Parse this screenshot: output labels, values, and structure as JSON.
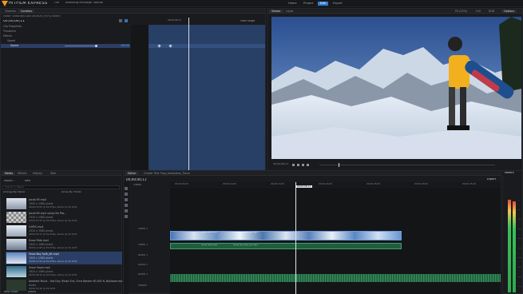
{
  "app": {
    "name": "HITFILM EXPRESS",
    "file_menu": "File",
    "project_title": "Boarding Montage Tutorial"
  },
  "workspace_tabs": [
    "Home",
    "Project",
    "Edit",
    "Export"
  ],
  "workspace_active": "Edit",
  "controls_panel": {
    "tabs": [
      "Trimmer",
      "Controls"
    ],
    "active_tab": "Controls",
    "header": "Editor: Snow Boy Split Alt(HDR_FNTN_Folder)",
    "timecode": "00;00;06;11",
    "ruler_label": "00;00;06;11",
    "view_label": "View Single",
    "tree": [
      "Clip Properties",
      "Transform",
      "Effects",
      "Speed",
      "Speed"
    ],
    "speed_value": "100.00"
  },
  "viewer": {
    "tabs": [
      "Viewer",
      "Layer"
    ],
    "active_tab": "Viewer",
    "zoom": "Fit (25%)",
    "quality": "Full",
    "colorspace": "RGB",
    "options_label": "Options",
    "timecode": "00;00;06;11"
  },
  "media_panel": {
    "tabs": [
      "Media",
      "Effects",
      "History",
      "Text"
    ],
    "active_tab": "Media",
    "import_label": "Import...",
    "new_label": "New",
    "search_placeholder": "Search in Media",
    "arrange_label": "Arrange By: Name",
    "group_label": "Group By: Folder",
    "items": [
      {
        "name": "Jacob lift.mp4",
        "info": "1920 x 1080 pixels",
        "detail": "00;00;15;02 @ 29.97fps, stereo @ 44.1kHz"
      },
      {
        "name": "Jacob lift.mp4 using the Pos...",
        "info": "1920 x 1080 pixels",
        "detail": "00;00;07;25 @ 29.97fps, stereo @ 44.1kHz"
      },
      {
        "name": "LUSEC.mp4",
        "info": "1920 x 1080 pixels",
        "detail": "00;00;03;11 @ 29.97fps, stereo @ 44.1kHz"
      },
      {
        "name": "Snow Ride.mp4",
        "info": "1920 x 1080 pixels",
        "detail": "00;00;12;08 @ 29.97fps, stereo @ 44.1kHz"
      },
      {
        "name": "Snow Boy Split_Alt.mp4",
        "info": "1920 x 1080 pixels",
        "detail": "00;00;11;04 @ 29.97fps, stereo @ 44.1kHz"
      },
      {
        "name": "Snow Slope.mp4",
        "info": "1920 x 1080 pixels",
        "detail": "00;00;09;16 @ 29.97fps, stereo @ 44.1kHz"
      },
      {
        "name": "Ambient Music - Hot Day (Music Ext, Chris Banker 90,000 ft, Ballroom.mp3)",
        "info": "Audio",
        "detail": "00;02;31;20 @ 44.1kHz"
      }
    ],
    "new_folder": "New Folder",
    "delete": "Delete"
  },
  "editor": {
    "tabs": [
      "Editor",
      "Create Title Flop_templates_Timer"
    ],
    "active_tab": "Editor",
    "timecode": "00;00;06;11",
    "playhead_label": "00;00;06;11",
    "export_label": "Export",
    "tracks_label": "Tracks",
    "ruler_ticks": [
      "00;00;05;00",
      "00;00;10;00",
      "00;00;15;00",
      "00;00;20;00",
      "00;00;25;00",
      "00;00;30;00",
      "00;00;35;00"
    ],
    "tracks": [
      "Video 2",
      "Video 1",
      "Audio 1",
      "Audio 2",
      "Audio 3",
      "Master"
    ],
    "video_clips": [
      {
        "label": "Snow Ride.mp4"
      },
      {
        "label": "Snow Boy Split_Alt.mp4"
      }
    ],
    "audio_clips": [
      {
        "label": "Snow Ride.mp4"
      },
      {
        "label": "Snow Boy Split_Alt.mp4"
      }
    ]
  },
  "meters": {
    "title": "Meters",
    "scale": [
      "0",
      "-6",
      "-12",
      "-18",
      "-24",
      "-30",
      "-36",
      "-42",
      "-48",
      "-54"
    ]
  },
  "colors": {
    "accent": "#2f7fd6",
    "logo": "#f29a1c",
    "video_clip": "#355fa0",
    "audio_clip": "#1f5e3c",
    "selection": "#2b3f66"
  }
}
